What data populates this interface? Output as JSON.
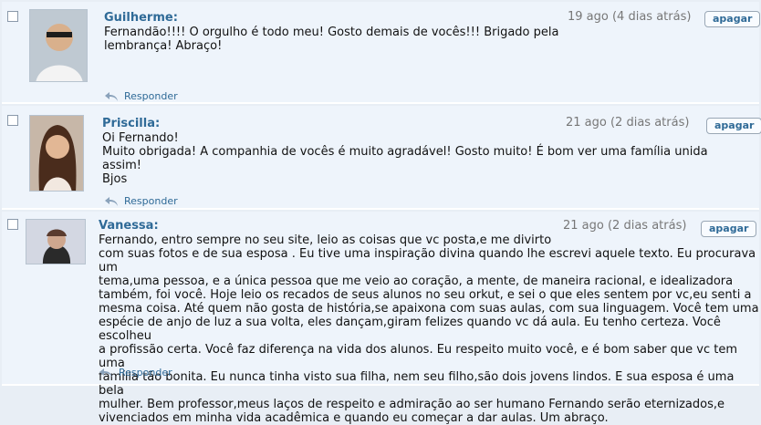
{
  "messages": [
    {
      "author": "Guilherme",
      "date": "19 ago (4 dias atrás)",
      "delete_label": "apagar",
      "text": "Fernandão!!!! O orgulho é todo meu! Gosto demais de vocês!!! Brigado pela\nlembrança! Abraço!",
      "reply_label": "Responder",
      "avatar_icon": "person-avatar-icon"
    },
    {
      "author": "Priscilla",
      "date": "21 ago (2 dias atrás)",
      "delete_label": "apagar",
      "text": "Oi Fernando!\nMuito obrigada! A companhia de vocês é muito agradável! Gosto muito! É bom ver uma família unida assim!\nBjos",
      "reply_label": "Responder",
      "avatar_icon": "person-avatar-icon"
    },
    {
      "author": "Vanessa",
      "date": "21 ago (2 dias atrás)",
      "delete_label": "apagar",
      "text": "Fernando, entro sempre no seu site, leio as coisas que vc posta,e me divirto\ncom suas fotos e de sua esposa . Eu tive uma inspiração divina quando lhe escrevi aquele texto. Eu procurava um\ntema,uma pessoa, e a única pessoa que me veio ao coração, a mente, de maneira racional, e idealizadora\ntambém, foi você. Hoje leio os recados de seus alunos no seu orkut, e sei o que eles sentem por vc,eu senti a\nmesma coisa. Até quem não gosta de história,se apaixona com suas aulas, com sua linguagem. Você tem uma\nespécie de anjo de luz a sua volta, eles dançam,giram felizes quando vc dá aula. Eu tenho certeza. Você escolheu\na profissão certa. Você faz diferença na vida dos alunos. Eu respeito muito você, e é bom saber que vc tem uma\nfamília tão bonita. Eu nunca tinha visto sua filha, nem seu filho,são dois jovens lindos. E sua esposa é uma bela\nmulher. Bem professor,meus laços de respeito e admiração ao ser humano Fernando serão eternizados,e\nvivenciados em minha vida acadêmica e quando eu começar a dar aulas. Um abraço.",
      "reply_label": "Responder",
      "avatar_icon": "person-avatar-icon"
    }
  ]
}
